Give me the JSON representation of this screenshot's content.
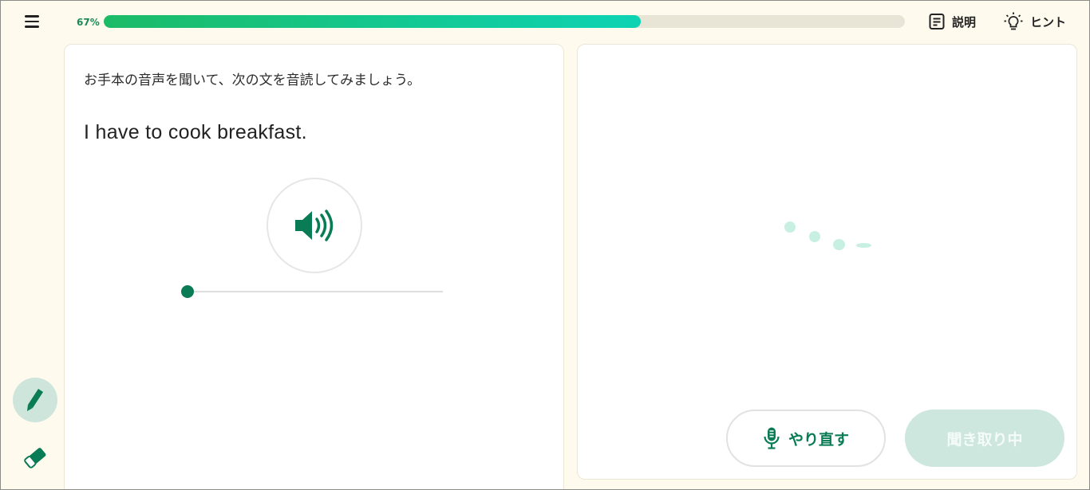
{
  "header": {
    "progress_label": "67%",
    "progress_value": 0.67,
    "explain_label": "説明",
    "hint_label": "ヒント"
  },
  "question": {
    "instruction": "お手本の音声を聞いて、次の文を音読してみましょう。",
    "sentence": "I have to cook breakfast."
  },
  "audio": {
    "position": 0
  },
  "actions": {
    "retry_label": "やり直す",
    "listening_label": "聞き取り中"
  },
  "icons": {
    "menu": "hamburger-icon",
    "explain": "document-icon",
    "hint": "lightbulb-icon",
    "play": "speaker-icon",
    "pen": "pencil-icon",
    "eraser": "eraser-icon",
    "mic": "microphone-icon"
  },
  "colors": {
    "accent": "#0a7c55",
    "progress_start": "#1cbb66",
    "progress_end": "#0dd3b4",
    "background": "#fefaed"
  }
}
